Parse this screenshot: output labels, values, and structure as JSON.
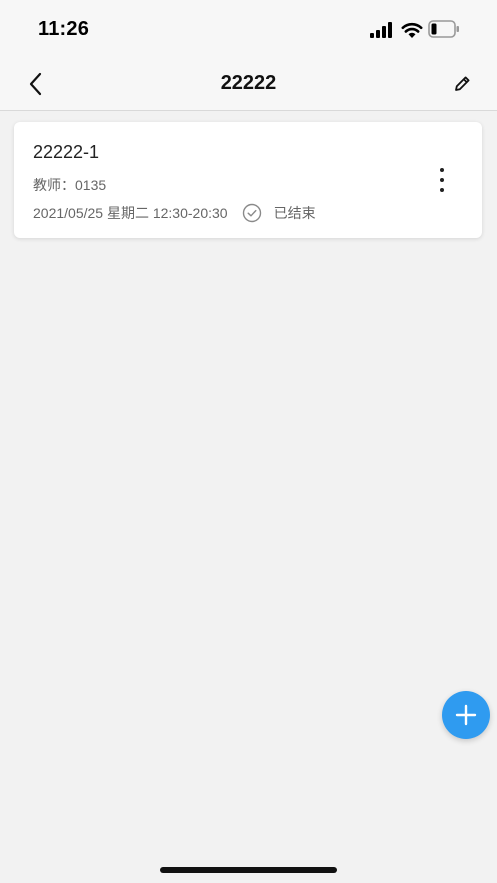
{
  "status_bar": {
    "time": "11:26",
    "icons": [
      "signal-icon",
      "wifi-icon",
      "battery-icon"
    ]
  },
  "nav": {
    "title": "22222",
    "back_icon": "chevron-left-icon",
    "edit_icon": "pencil-icon"
  },
  "lessons": [
    {
      "title": "22222-1",
      "teacher": "教师：0135",
      "datetime": "2021/05/25 星期二 12:30-20:30",
      "status": "已结束",
      "status_icon": "check-circle-icon",
      "more_icon": "more-vertical-icon"
    }
  ],
  "fab": {
    "icon": "plus-icon",
    "color": "#2f9bf0"
  },
  "colors": {
    "background": "#f2f2f2",
    "accent": "#2f9bf0"
  }
}
